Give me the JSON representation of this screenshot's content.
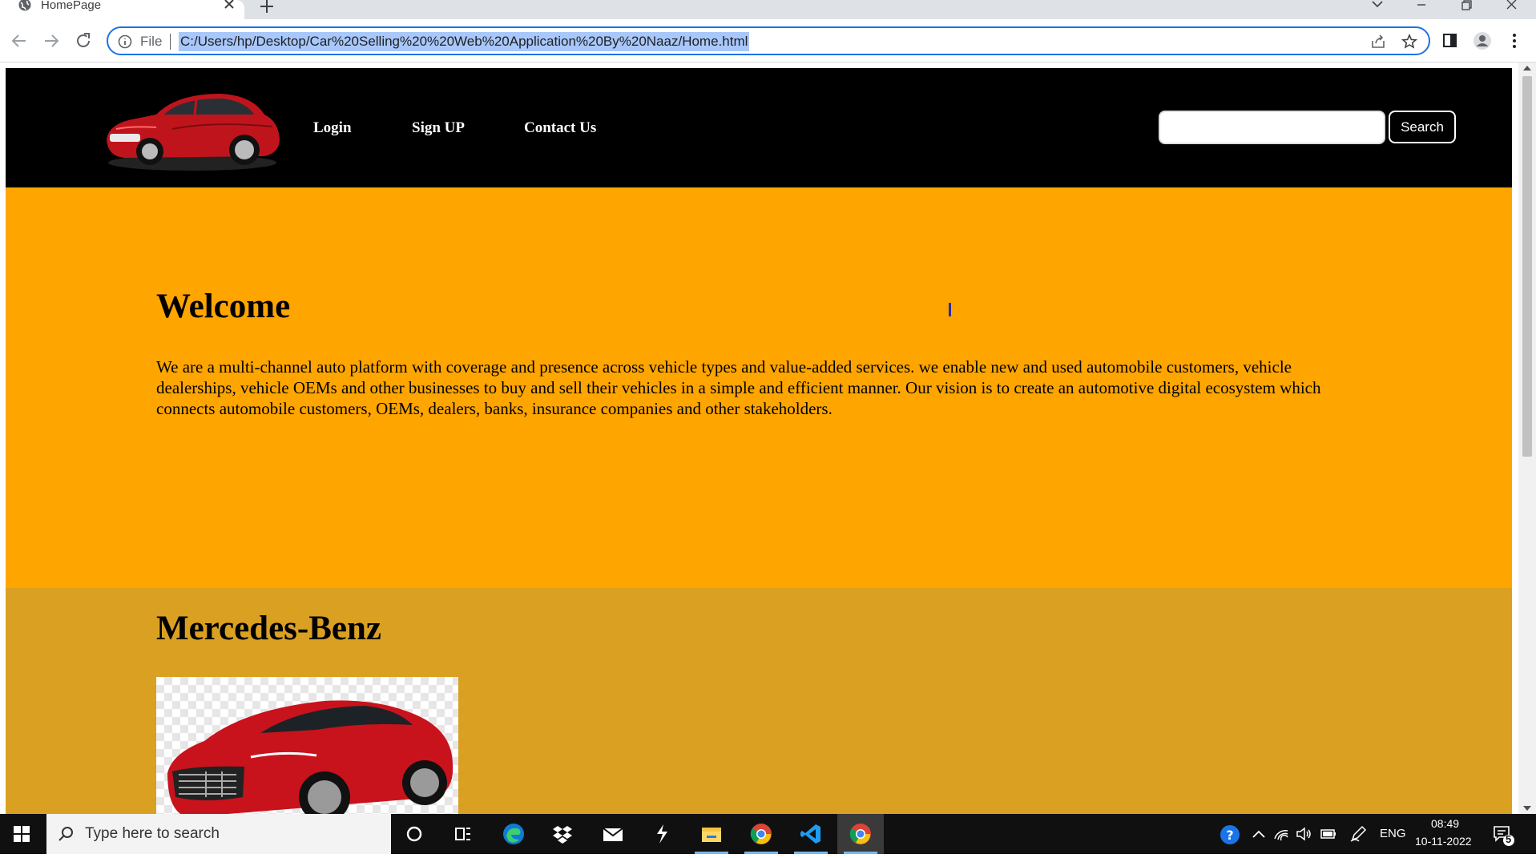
{
  "browser": {
    "tab_title": "HomePage",
    "omnibox": {
      "scheme_label": "File",
      "url": "C:/Users/hp/Desktop/Car%20Selling%20%20Web%20Application%20By%20Naaz/Home.html"
    }
  },
  "site": {
    "nav": {
      "login": "Login",
      "signup": "Sign UP",
      "contact": "Contact Us"
    },
    "search": {
      "value": "",
      "button": "Search"
    },
    "welcome": {
      "heading": "Welcome",
      "text": "We are a multi-channel auto platform with coverage and presence across vehicle types and value-added services. we enable new and used automobile customers, vehicle dealerships, vehicle OEMs and other businesses to buy and sell their vehicles in a simple and efficient manner. Our vision is to create an automotive digital ecosystem which connects automobile customers, OEMs, dealers, banks, insurance companies and other stakeholders."
    },
    "brand": {
      "heading": "Mercedes-Benz"
    },
    "colors": {
      "header_bg": "#000000",
      "welcome_bg": "#ffa500",
      "brand_bg": "#daa021"
    }
  },
  "taskbar": {
    "search_placeholder": "Type here to search",
    "apps": [
      "cortana-icon",
      "task-view-icon",
      "edge-icon",
      "dropbox-icon",
      "mail-icon",
      "app-icon",
      "file-explorer-icon",
      "chrome-icon",
      "vscode-icon",
      "chrome-icon"
    ],
    "language": "ENG",
    "time": "08:49",
    "date": "10-11-2022",
    "notification_count": "5"
  }
}
